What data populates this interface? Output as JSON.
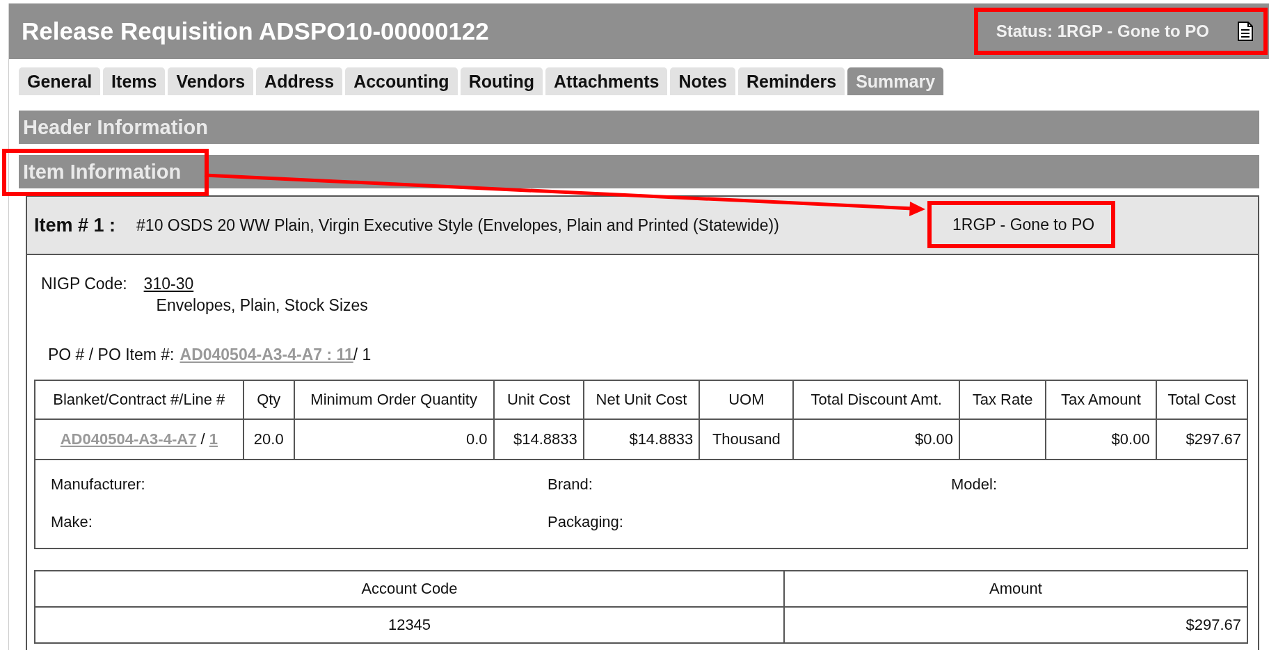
{
  "title": "Release Requisition ADSPO10-00000122",
  "status": {
    "text": "Status: 1RGP - Gone to PO",
    "highlighted": true
  },
  "tabs": [
    {
      "label": "General",
      "selected": false
    },
    {
      "label": "Items",
      "selected": false
    },
    {
      "label": "Vendors",
      "selected": false
    },
    {
      "label": "Address",
      "selected": false
    },
    {
      "label": "Accounting",
      "selected": false
    },
    {
      "label": "Routing",
      "selected": false
    },
    {
      "label": "Attachments",
      "selected": false
    },
    {
      "label": "Notes",
      "selected": false
    },
    {
      "label": "Reminders",
      "selected": false
    },
    {
      "label": "Summary",
      "selected": true
    }
  ],
  "sections": [
    {
      "title": "Header Information",
      "highlighted": false
    },
    {
      "title": "Item Information",
      "highlighted": true
    }
  ],
  "item": {
    "label": "Item # 1 :",
    "description": "#10 OSDS 20 WW Plain, Virgin Executive Style (Envelopes, Plain and Printed (Statewide))",
    "status": "1RGP - Gone to PO",
    "status_highlighted": true,
    "nigp_label": "NIGP Code:",
    "nigp_code": "310-30",
    "nigp_description": "Envelopes, Plain, Stock Sizes",
    "po_label": "PO # / PO Item #:",
    "po_link": "AD040504-A3-4-A7 : 11 ",
    "po_item": "/ 1",
    "columns": [
      "Blanket/Contract #/Line #",
      "Qty",
      "Minimum Order Quantity",
      "Unit Cost",
      "Net Unit Cost",
      "UOM",
      "Total Discount Amt.",
      "Tax Rate",
      "Tax Amount",
      "Total Cost"
    ],
    "row": {
      "contract_link": "AD040504-A3-4-A7",
      "separator": " / ",
      "line_link": "1",
      "qty": "20.0",
      "min_qty": "0.0",
      "unit_cost": "$14.8833",
      "net_unit_cost": "$14.8833",
      "uom": "Thousand",
      "discount": "$0.00",
      "tax_amount": "$0.00",
      "total_cost": "$297.67"
    },
    "details": [
      {
        "label": "Manufacturer:"
      },
      {
        "label": "Brand:"
      },
      {
        "label": "Model:"
      },
      {
        "label": "Make:"
      },
      {
        "label": "Packaging:"
      }
    ],
    "accounting": {
      "columns": [
        "Account Code",
        "Amount"
      ],
      "rows": [
        [
          "12345",
          "$297.67"
        ]
      ]
    }
  }
}
